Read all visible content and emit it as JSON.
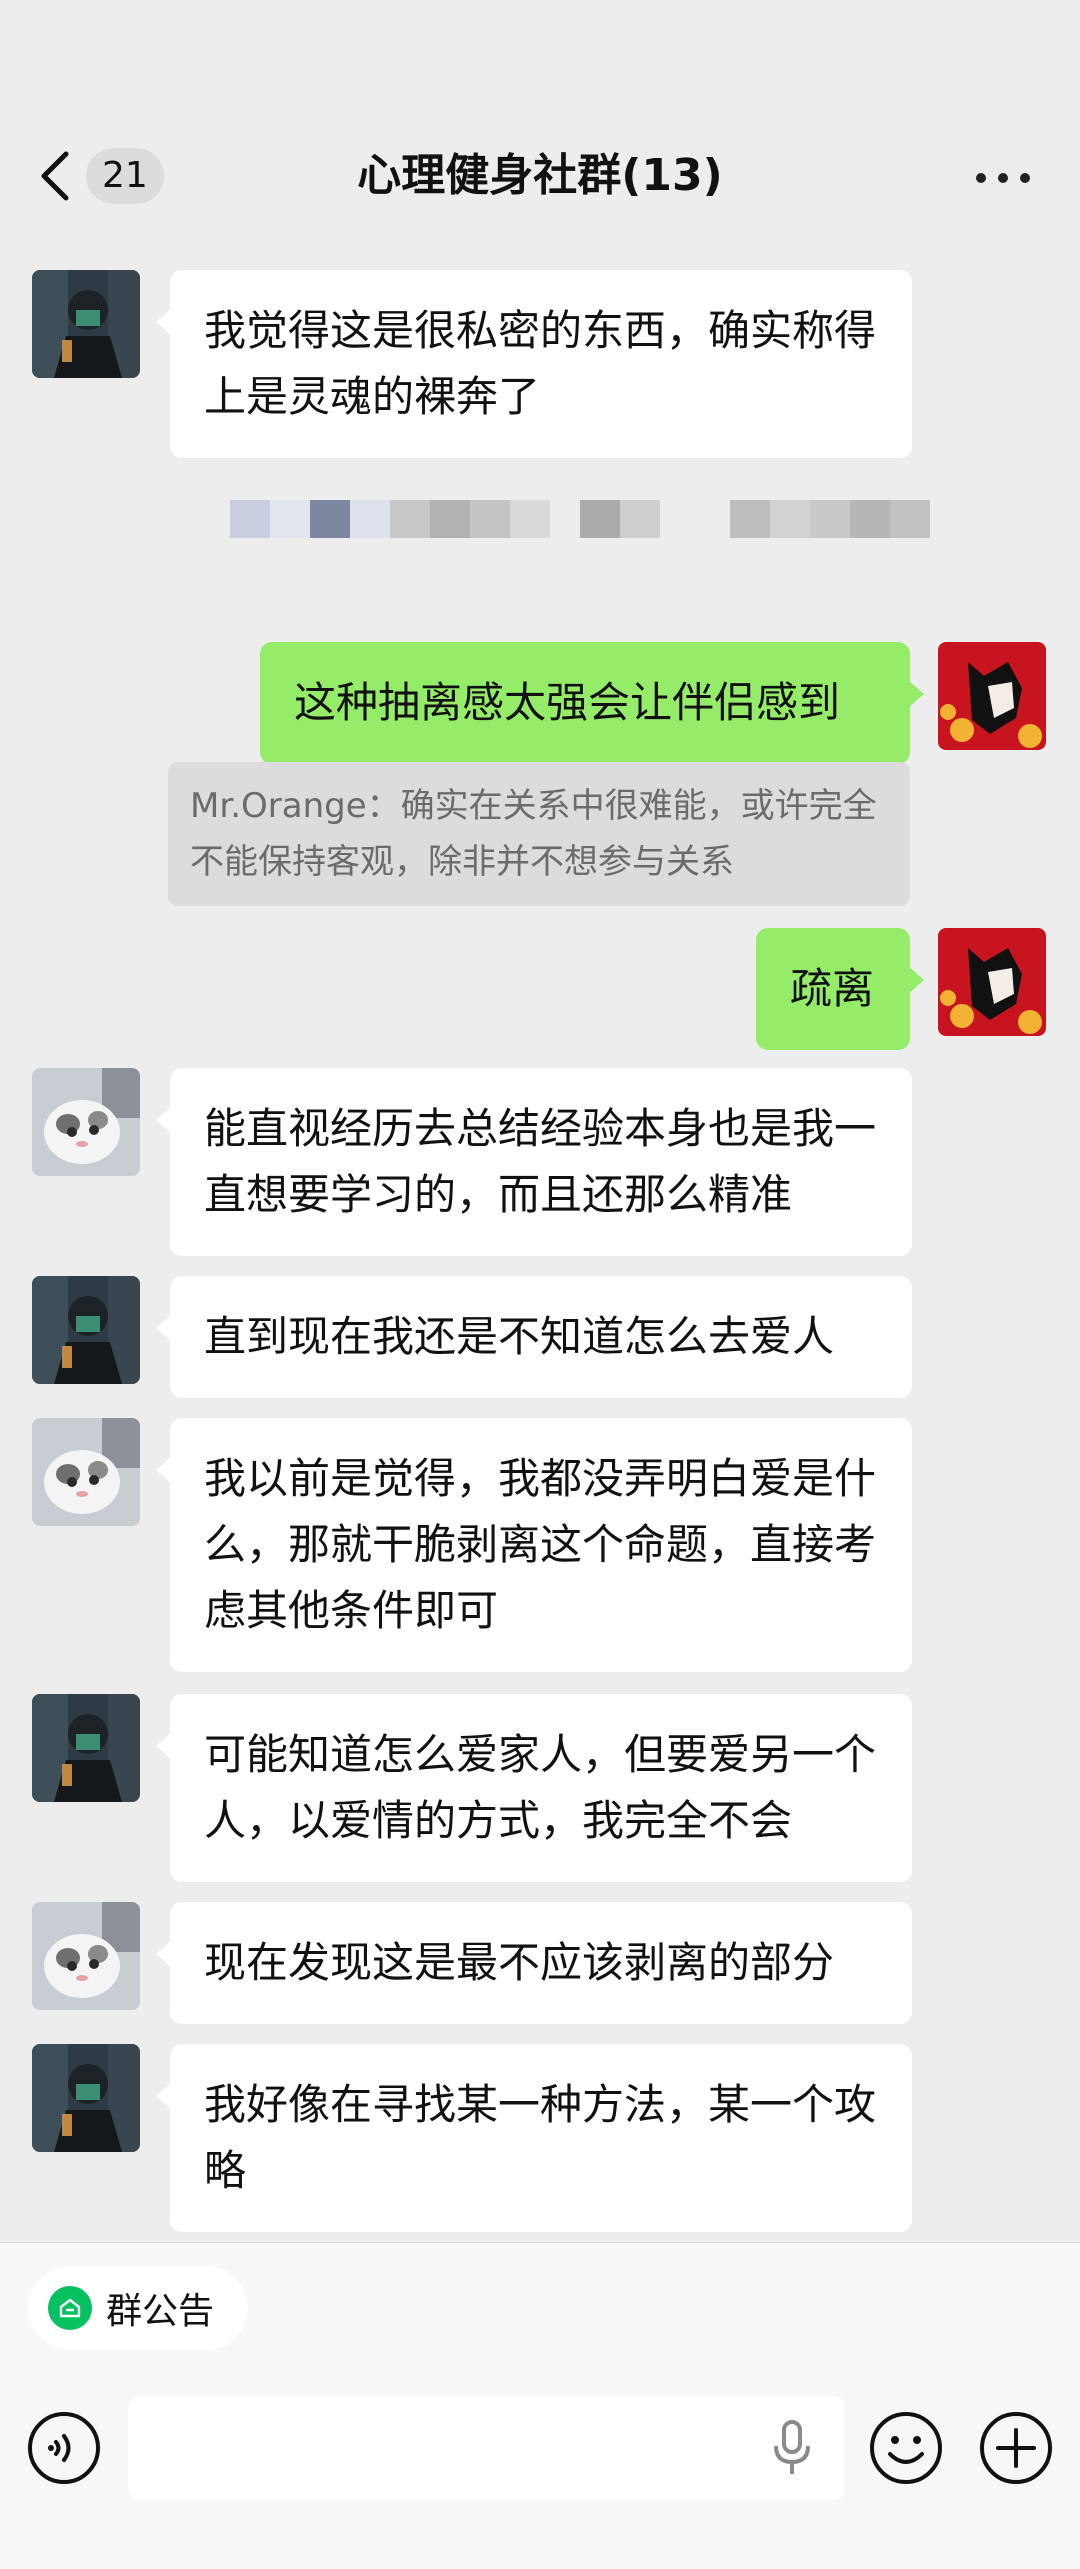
{
  "header": {
    "unread_count": "21",
    "title": "心理健身社群(13)"
  },
  "messages": [
    {
      "sender": "dark-avatar",
      "side": "left",
      "text": "我觉得这是很私密的东西，确实称得上是灵魂的裸奔了"
    },
    {
      "sender": "self",
      "side": "right",
      "text": "这种抽离感太强会让伴侣感到",
      "quote": "Mr.Orange：确实在关系中很难能，或许完全不能保持客观，除非并不想参与关系"
    },
    {
      "sender": "self",
      "side": "right",
      "text": "疏离"
    },
    {
      "sender": "cat-avatar",
      "side": "left",
      "text": "能直视经历去总结经验本身也是我一直想要学习的，而且还那么精准"
    },
    {
      "sender": "dark-avatar",
      "side": "left",
      "text": "直到现在我还是不知道怎么去爱人"
    },
    {
      "sender": "cat-avatar",
      "side": "left",
      "text": "我以前是觉得，我都没弄明白爱是什么，那就干脆剥离这个命题，直接考虑其他条件即可"
    },
    {
      "sender": "dark-avatar",
      "side": "left",
      "text": "可能知道怎么爱家人，但要爱另一个人，以爱情的方式，我完全不会"
    },
    {
      "sender": "cat-avatar",
      "side": "left",
      "text": "现在发现这是最不应该剥离的部分"
    },
    {
      "sender": "dark-avatar",
      "side": "left",
      "text": "我好像在寻找某一种方法，某一个攻略"
    }
  ],
  "bottom_bar": {
    "announcement_label": "群公告"
  },
  "colors": {
    "background": "#ededed",
    "self_bubble": "#95ec69",
    "other_bubble": "#ffffff",
    "quote_bg": "#dcdcdc",
    "accent_green": "#07c160"
  },
  "icons": [
    "back-chevron-icon",
    "more-dots-icon",
    "announcement-icon",
    "voice-icon",
    "microphone-icon",
    "emoji-icon",
    "plus-icon"
  ]
}
